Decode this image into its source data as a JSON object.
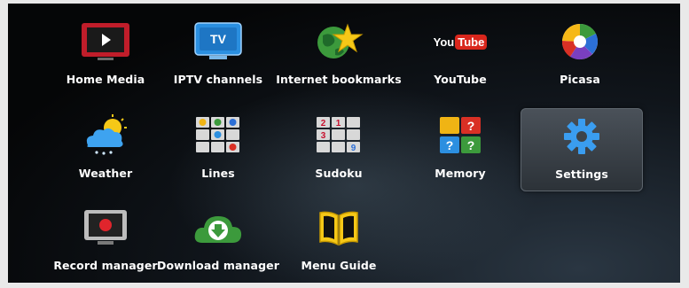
{
  "menu": {
    "items": [
      {
        "label": "Home Media",
        "icon": "home-media-icon"
      },
      {
        "label": "IPTV channels",
        "icon": "tv-icon"
      },
      {
        "label": "Internet bookmarks",
        "icon": "globe-star-icon"
      },
      {
        "label": "YouTube",
        "icon": "youtube-icon"
      },
      {
        "label": "Picasa",
        "icon": "picasa-icon"
      },
      {
        "label": "Weather",
        "icon": "weather-icon"
      },
      {
        "label": "Lines",
        "icon": "lines-game-icon"
      },
      {
        "label": "Sudoku",
        "icon": "sudoku-icon"
      },
      {
        "label": "Memory",
        "icon": "memory-game-icon"
      },
      {
        "label": "Settings",
        "icon": "gear-icon"
      },
      {
        "label": "Record manager",
        "icon": "record-icon"
      },
      {
        "label": "Download manager",
        "icon": "download-cloud-icon"
      },
      {
        "label": "Menu Guide",
        "icon": "book-icon"
      }
    ],
    "selected": "Settings"
  },
  "icon_text": {
    "tv": "TV",
    "youtube_you": "You",
    "youtube_tube": "Tube",
    "sudoku": [
      "2",
      "1",
      "3",
      "9"
    ],
    "memory": [
      "?",
      "?",
      "?"
    ]
  },
  "colors": {
    "selected_bg": "#3c434a",
    "label": "#ffffff",
    "accent_blue": "#2c8fe0",
    "accent_red": "#c8102e"
  }
}
